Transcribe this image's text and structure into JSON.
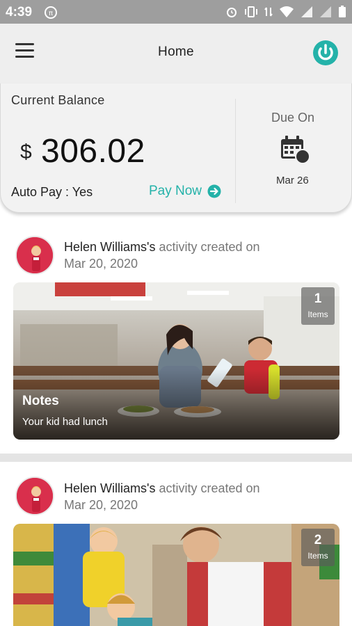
{
  "status_bar": {
    "time": "4:39"
  },
  "app_bar": {
    "title": "Home",
    "menu_icon": "hamburger-menu-icon",
    "power_icon": "power-icon"
  },
  "balance": {
    "label": "Current Balance",
    "currency": "$",
    "amount": "306.02",
    "autopay": "Auto Pay : Yes",
    "pay_now": "Pay Now",
    "due_label": "Due On",
    "due_date": "Mar 26"
  },
  "activities": [
    {
      "name": "Helen Williams's",
      "suffix": " activity created on",
      "date": "Mar 20, 2020",
      "count": "1",
      "count_label": "Items",
      "note_title": "Notes",
      "note_text": "Your kid had lunch"
    },
    {
      "name": "Helen Williams's",
      "suffix": " activity created on",
      "date": "Mar 20, 2020",
      "count": "2",
      "count_label": "Items"
    }
  ],
  "colors": {
    "accent": "#24b2a9",
    "avatar_bg": "#d92f4c",
    "status_bar": "#9e9e9e"
  }
}
